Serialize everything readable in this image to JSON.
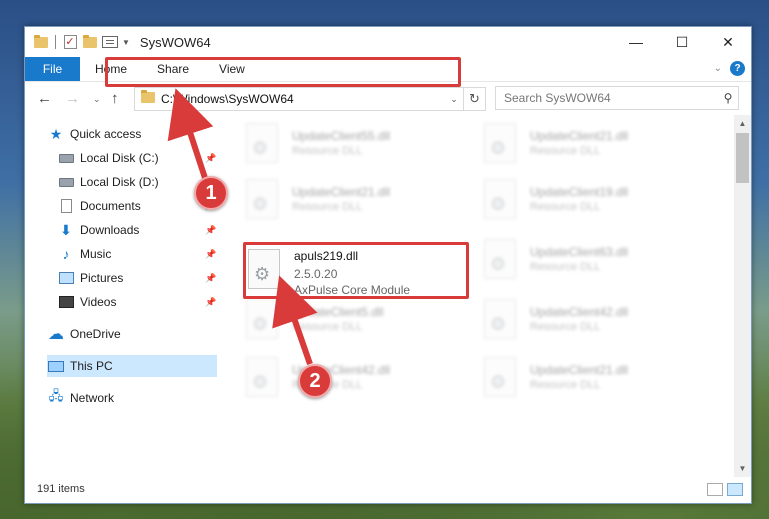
{
  "window": {
    "title": "SysWOW64",
    "controls": {
      "minimize": "—",
      "maximize": "☐",
      "close": "✕"
    }
  },
  "ribbon": {
    "tabs": [
      "File",
      "Home",
      "Share",
      "View"
    ],
    "expand": "⌄",
    "help": "?"
  },
  "navigation": {
    "back": "←",
    "forward": "→",
    "recent": "⌄",
    "up": "↑",
    "address": "C:\\Windows\\SysWOW64",
    "dropdown": "⌄",
    "refresh": "↻",
    "search_placeholder": "Search SysWOW64",
    "search_icon": "⚲"
  },
  "sidebar": {
    "items": [
      {
        "label": "Quick access",
        "icon": "star-icon"
      },
      {
        "label": "Local Disk (C:)",
        "icon": "disk-icon",
        "pinned": true
      },
      {
        "label": "Local Disk (D:)",
        "icon": "disk-icon",
        "pinned": false
      },
      {
        "label": "Documents",
        "icon": "document-icon",
        "pinned": true
      },
      {
        "label": "Downloads",
        "icon": "download-icon",
        "pinned": true
      },
      {
        "label": "Music",
        "icon": "music-icon",
        "pinned": true
      },
      {
        "label": "Pictures",
        "icon": "picture-icon",
        "pinned": true
      },
      {
        "label": "Videos",
        "icon": "video-icon",
        "pinned": true
      },
      {
        "label": "OneDrive",
        "icon": "cloud-icon"
      },
      {
        "label": "This PC",
        "icon": "computer-icon",
        "selected": true
      },
      {
        "label": "Network",
        "icon": "network-icon"
      }
    ],
    "pin_glyph": "📌"
  },
  "files": {
    "left": [
      {
        "name": "UpdateClient55.dll",
        "desc": "Resource DLL"
      },
      {
        "name": "UpdateClient21.dll",
        "desc": "Resource DLL"
      },
      {
        "name": "UpdateClient5.dll",
        "desc": "Resource DLL"
      },
      {
        "name": "UpdateClient42.dll",
        "desc": "Resource DLL"
      }
    ],
    "right": [
      {
        "name": "UpdateClient21.dll",
        "desc": "Resource DLL"
      },
      {
        "name": "UpdateClient19.dll",
        "desc": "Resource DLL"
      },
      {
        "name": "UpdateClient63.dll",
        "desc": "Resource DLL"
      },
      {
        "name": "UpdateClient42.dll",
        "desc": "Resource DLL"
      },
      {
        "name": "UpdateClient21.dll",
        "desc": "Resource DLL"
      }
    ],
    "highlighted": {
      "name": "apuls219.dll",
      "version": "2.5.0.20",
      "desc": "AxPulse Core Module"
    }
  },
  "status": {
    "count": "191 items"
  },
  "callouts": {
    "one": "1",
    "two": "2"
  },
  "colors": {
    "accent": "#1979ca",
    "callout": "#d93b3b",
    "selection": "#cce8ff"
  }
}
